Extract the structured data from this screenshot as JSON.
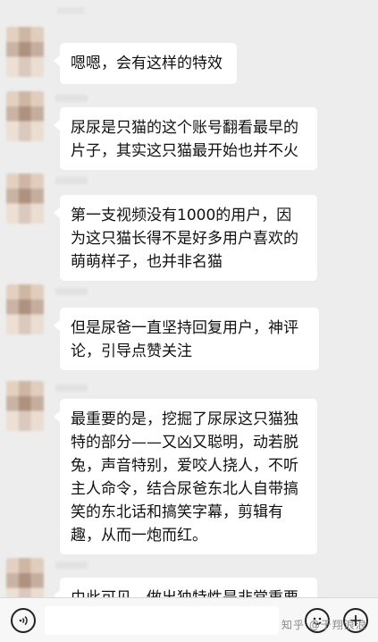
{
  "messages": [
    {
      "text": "嗯嗯，会有这样的特效"
    },
    {
      "text": "尿尿是只猫的这个账号翻看最早的片子，其实这只猫最开始也并不火"
    },
    {
      "text": "第一支视频没有1000的用户，因为这只猫长得不是好多用户喜欢的萌萌样子，也并非名猫"
    },
    {
      "text": "但是尿爸一直坚持回复用户，神评论，引导点赞关注"
    },
    {
      "text": "最重要的是，挖掘了尿尿这只猫独特的部分——又凶又聪明，动若脱兔，声音特别，爱咬人挠人，不听主人命令，结合尿爸东北人自带搞笑的东北话和搞笑字幕，剪辑有趣，从而一炮而红。"
    },
    {
      "text": "由此可见，做出独特性是非常重要"
    }
  ],
  "bottom_bar": {
    "voice_icon": "voice-icon",
    "emoji_icon": "emoji-icon",
    "plus_icon": "plus-icon"
  },
  "watermark": "知乎 @于翔浪浪"
}
